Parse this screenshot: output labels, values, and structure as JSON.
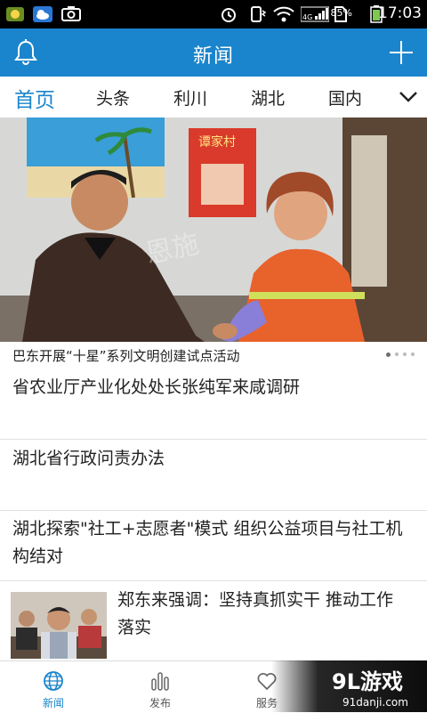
{
  "status_bar": {
    "time": "17:03",
    "battery_percent": "85%",
    "network": "4G",
    "icons": [
      "app-icon",
      "weather-icon",
      "camera-icon",
      "alarm-icon",
      "vibrate-icon",
      "wifi-icon",
      "signal-icon",
      "sim-icon",
      "battery-icon"
    ]
  },
  "app_bar": {
    "title": "新闻",
    "left_icon": "bell-icon",
    "right_icon": "plus-icon"
  },
  "tabs": {
    "items": [
      "首页",
      "头条",
      "利川",
      "湖北",
      "国内"
    ],
    "active": "首页"
  },
  "hero": {
    "caption": "巴东开展“十星”系列文明创建试点活动",
    "poster_text": "谭家村",
    "dots_total": 4,
    "dots_active": 1
  },
  "news": [
    {
      "title": "省农业厅产业化处处长张纯军来咸调研"
    },
    {
      "title": "湖北省行政问责办法"
    },
    {
      "title": "湖北探索\"社工+志愿者\"模式 组织公益项目与社工机构结对"
    },
    {
      "title": "郑东来强调：坚持真抓实干 推动工作落实"
    }
  ],
  "bottom_nav": [
    {
      "label": "新闻",
      "icon": "globe-icon",
      "active": true
    },
    {
      "label": "发布",
      "icon": "bars-icon",
      "active": false
    },
    {
      "label": "服务",
      "icon": "heart-icon",
      "active": false
    }
  ],
  "watermark": {
    "brand": "9L游戏",
    "url": "91danji.com"
  },
  "colors": {
    "accent": "#1a85cc",
    "status_bar": "#000000",
    "divider": "#e1e1e1"
  }
}
